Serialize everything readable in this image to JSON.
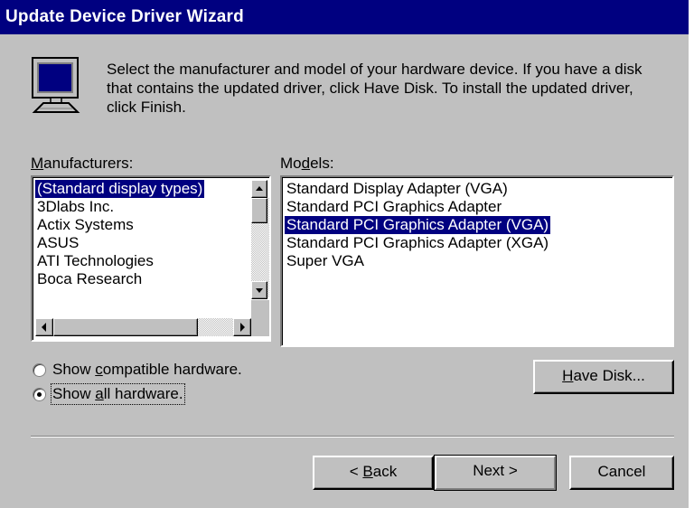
{
  "window": {
    "title": "Update Device Driver Wizard"
  },
  "intro": {
    "text": "Select the manufacturer and model of your hardware device. If you have a disk that contains the updated driver, click Have Disk. To install the updated driver, click Finish."
  },
  "manufacturers": {
    "label_accel": "M",
    "label_rest": "anufacturers:",
    "items": [
      "(Standard display types)",
      "3Dlabs Inc.",
      "Actix Systems",
      "ASUS",
      "ATI Technologies",
      "Boca Research"
    ],
    "selected_index": 0
  },
  "models": {
    "label_pre": "Mo",
    "label_accel": "d",
    "label_rest": "els:",
    "items": [
      "Standard Display Adapter (VGA)",
      "Standard PCI Graphics Adapter",
      "Standard PCI Graphics Adapter (VGA)",
      "Standard PCI Graphics Adapter (XGA)",
      "Super VGA"
    ],
    "selected_index": 2
  },
  "options": {
    "compatible": {
      "pre": "Show ",
      "accel": "c",
      "rest": "ompatible hardware.",
      "checked": false
    },
    "all": {
      "pre": "Show ",
      "accel": "a",
      "rest": "ll hardware.",
      "checked": true
    }
  },
  "buttons": {
    "have_disk": {
      "accel": "H",
      "rest": "ave Disk..."
    },
    "back": {
      "pre": "< ",
      "accel": "B",
      "rest": "ack"
    },
    "next": "Next >",
    "cancel": "Cancel"
  },
  "icons": {
    "monitor": "monitor-icon",
    "scroll_up": "triangle-up",
    "scroll_down": "triangle-down",
    "scroll_left": "triangle-left",
    "scroll_right": "triangle-right"
  },
  "colors": {
    "title_bar": "#000080",
    "selection": "#000080",
    "face": "#c0c0c0"
  }
}
